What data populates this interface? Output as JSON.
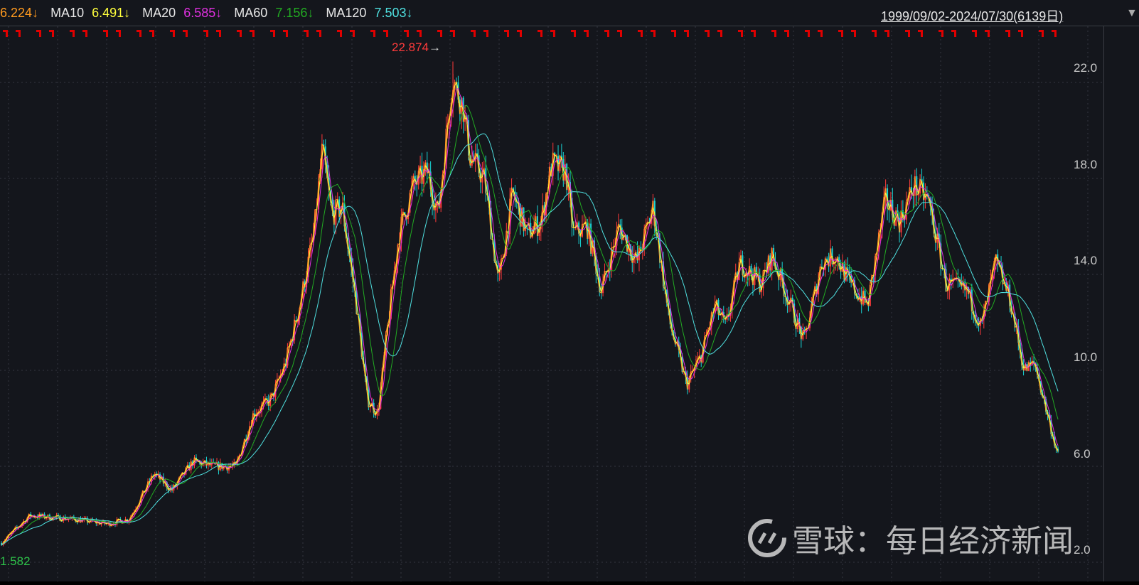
{
  "header": {
    "ma5_value": "6.224↓",
    "ma10_label": "MA10",
    "ma10_value": "6.491↓",
    "ma20_label": "MA20",
    "ma20_value": "6.585↓",
    "ma60_label": "MA60",
    "ma60_value": "7.156↓",
    "ma120_label": "MA120",
    "ma120_value": "7.503↓",
    "range": "1999/09/02-2024/07/30(6139日)",
    "range_arrow": "▼"
  },
  "colors": {
    "up": "#ff3a3a",
    "down": "#19d6d6",
    "ma5": "#ff9a1f",
    "ma10": "#ffff3c",
    "ma20": "#e030e0",
    "ma60": "#22aa22",
    "ma120": "#4fe0e0",
    "grid": "#333740"
  },
  "watermark": {
    "logo": "雪球",
    "text": "雪球：每日经济新闻"
  },
  "chart_data": {
    "type": "candlestick",
    "title": "",
    "date_range": [
      "1999/09/02",
      "2024/07/30"
    ],
    "trading_days": 6139,
    "ylim": [
      1.5,
      24
    ],
    "yticks": [
      "22.0",
      "18.0",
      "14.0",
      "10.0",
      "6.0",
      "2.0"
    ],
    "ytick_values": [
      22,
      18,
      14,
      10,
      6,
      2
    ],
    "high_label": "22.874",
    "high_value": 22.874,
    "low_label": "1.582",
    "low_value": 1.582,
    "moving_averages": [
      5,
      10,
      20,
      60,
      120
    ],
    "price_path": [
      [
        0,
        2.8
      ],
      [
        165,
        3.95
      ],
      [
        412,
        3.8
      ],
      [
        618,
        3.6
      ],
      [
        742,
        3.8
      ],
      [
        886,
        5.7
      ],
      [
        989,
        5.0
      ],
      [
        1112,
        6.2
      ],
      [
        1236,
        6.0
      ],
      [
        1360,
        6.0
      ],
      [
        1463,
        8.2
      ],
      [
        1566,
        8.8
      ],
      [
        1648,
        10.3
      ],
      [
        1730,
        12.7
      ],
      [
        1813,
        15.7
      ],
      [
        1862,
        19.2
      ],
      [
        1916,
        16.5
      ],
      [
        1978,
        16.8
      ],
      [
        2060,
        12.7
      ],
      [
        2122,
        8.8
      ],
      [
        2184,
        8.2
      ],
      [
        2245,
        12.1
      ],
      [
        2307,
        15.7
      ],
      [
        2390,
        17.7
      ],
      [
        2472,
        18.3
      ],
      [
        2534,
        16.5
      ],
      [
        2616,
        22.2
      ],
      [
        2678,
        21.0
      ],
      [
        2719,
        18.9
      ],
      [
        2802,
        18.0
      ],
      [
        2884,
        13.6
      ],
      [
        2966,
        17.4
      ],
      [
        3049,
        15.7
      ],
      [
        3131,
        16.2
      ],
      [
        3193,
        18.6
      ],
      [
        3275,
        18.3
      ],
      [
        3317,
        15.7
      ],
      [
        3399,
        16.0
      ],
      [
        3481,
        13.3
      ],
      [
        3584,
        16.0
      ],
      [
        3687,
        14.5
      ],
      [
        3782,
        16.8
      ],
      [
        3873,
        12.1
      ],
      [
        3976,
        9.4
      ],
      [
        4058,
        10.6
      ],
      [
        4141,
        12.7
      ],
      [
        4202,
        11.8
      ],
      [
        4285,
        14.5
      ],
      [
        4408,
        13.6
      ],
      [
        4470,
        14.8
      ],
      [
        4532,
        13.6
      ],
      [
        4656,
        11.2
      ],
      [
        4759,
        14.5
      ],
      [
        4841,
        14.8
      ],
      [
        4923,
        13.6
      ],
      [
        5026,
        12.7
      ],
      [
        5129,
        17.1
      ],
      [
        5212,
        16.2
      ],
      [
        5294,
        17.7
      ],
      [
        5377,
        17.1
      ],
      [
        5480,
        13.6
      ],
      [
        5603,
        13.3
      ],
      [
        5685,
        11.8
      ],
      [
        5768,
        14.5
      ],
      [
        5850,
        13.0
      ],
      [
        5933,
        10.0
      ],
      [
        5995,
        10.3
      ],
      [
        6056,
        8.5
      ],
      [
        6138,
        6.22
      ]
    ]
  }
}
